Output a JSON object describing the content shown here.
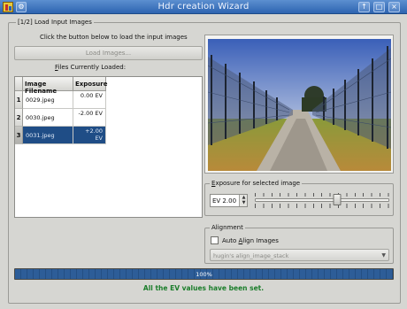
{
  "window": {
    "title": "Hdr creation Wizard",
    "menu_button": "⚙",
    "buttons": {
      "up": "↑",
      "max": "□",
      "close": "×"
    }
  },
  "step_group": {
    "title": "[1/2] Load Input Images",
    "instruction": "Click the button below to load the input images",
    "load_button": "Load Images...",
    "files_label_mnemonic": "F",
    "files_label_rest": "iles Currently Loaded:"
  },
  "table": {
    "headers": {
      "filename": "Image Filename",
      "exposure": "Exposure"
    },
    "rows": [
      {
        "num": "1",
        "file": "0029.jpeg",
        "exposure": "0.00 EV"
      },
      {
        "num": "2",
        "file": "0030.jpeg",
        "exposure": "-2.00 EV"
      },
      {
        "num": "3",
        "file": "0031.jpeg",
        "exposure": "+2.00 EV"
      }
    ],
    "selected_row": 2
  },
  "exposure": {
    "group_mnemonic": "E",
    "group_rest": "xposure for selected image",
    "value": "EV 2.00",
    "slider_position": 0.61
  },
  "alignment": {
    "group_title": "Alignment",
    "checkbox_label_pre": "Auto ",
    "checkbox_mnemonic": "A",
    "checkbox_label_post": "lign Images",
    "checked": false,
    "combo_value": "hugin's align_image_stack"
  },
  "progress": {
    "value": 100,
    "label": "100%"
  },
  "status": "All the EV values have been set.",
  "colors": {
    "titlebar": "#3f74bf",
    "selection": "#1f4d86",
    "progress": "#2d5d98",
    "status": "#1a7d2a"
  }
}
